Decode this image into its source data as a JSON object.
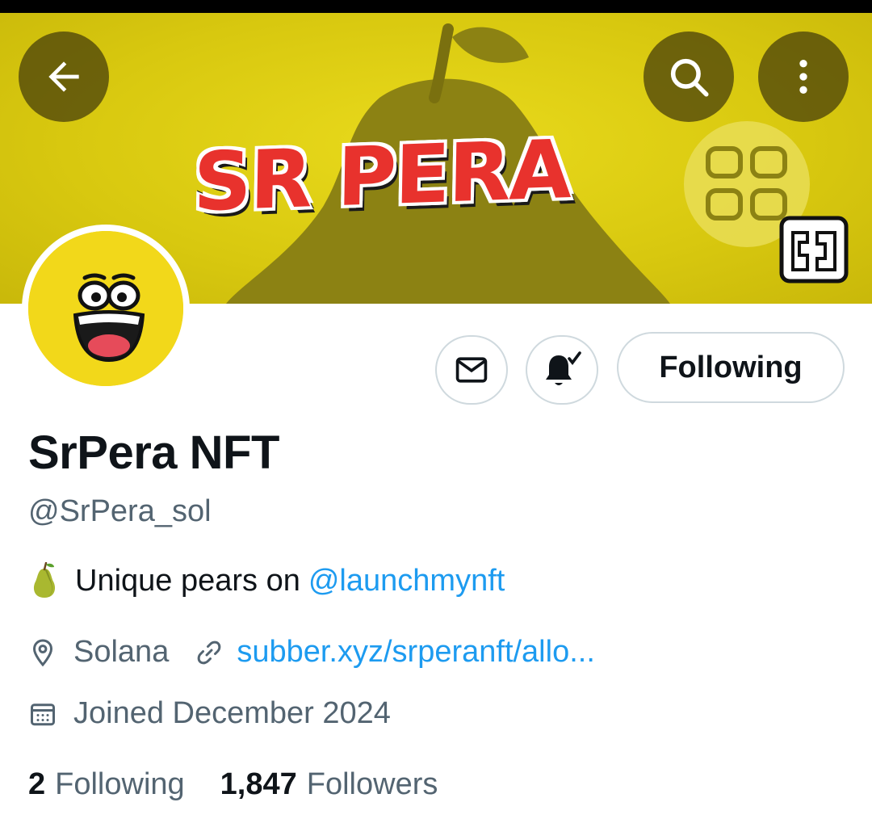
{
  "header": {
    "banner_text": "SR PERA",
    "back_icon": "arrow-left-icon",
    "search_icon": "search-icon",
    "more_icon": "more-vertical-icon"
  },
  "actions": {
    "message_icon": "mail-icon",
    "notifications_icon": "bell-check-icon",
    "follow_button_label": "Following"
  },
  "profile": {
    "display_name": "SrPera NFT",
    "handle": "@SrPera_sol",
    "bio_emoji": "pear-emoji",
    "bio_text": "Unique pears on ",
    "bio_mention": "@launchmynft",
    "location": "Solana",
    "website": "subber.xyz/srperanft/allo...",
    "joined": "Joined December 2024"
  },
  "stats": {
    "following_count": "2",
    "following_label": "Following",
    "followers_count": "1,847",
    "followers_label": "Followers"
  },
  "colors": {
    "banner_yellow": "#dccb12",
    "link_blue": "#1d9bf0",
    "secondary_text": "#536471",
    "primary_text": "#0f1419",
    "border": "#cfd9de"
  }
}
